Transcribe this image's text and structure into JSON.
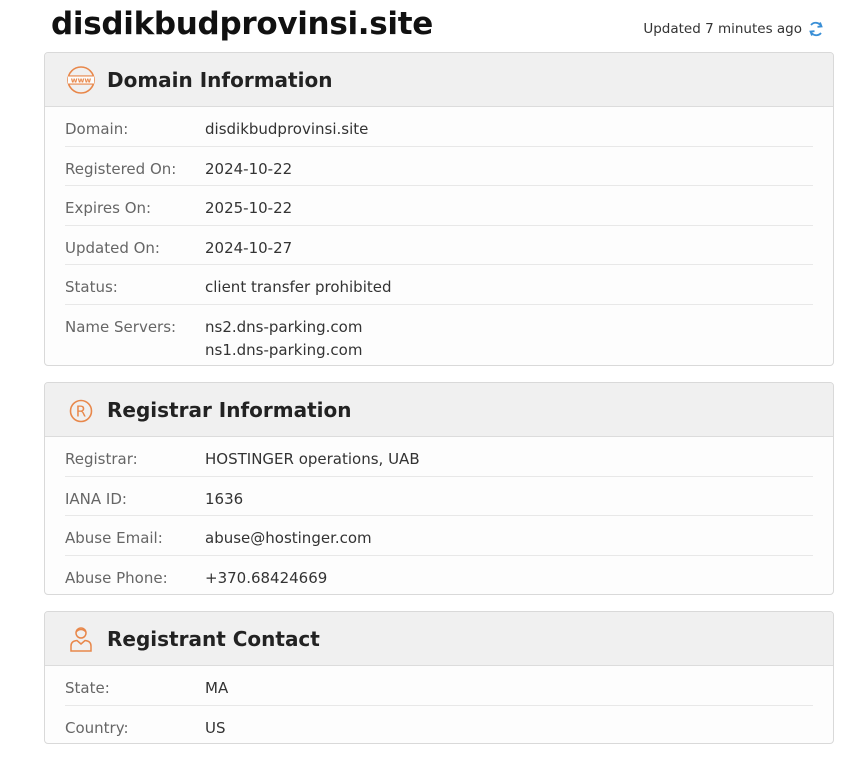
{
  "header": {
    "site_title": "disdikbudprovinsi.site",
    "updated_text": "Updated 7 minutes ago",
    "refresh_icon": "refresh-icon"
  },
  "domain_info": {
    "title": "Domain Information",
    "icon": "www-icon",
    "rows": [
      {
        "label": "Domain:",
        "value": "disdikbudprovinsi.site"
      },
      {
        "label": "Registered On:",
        "value": "2024-10-22"
      },
      {
        "label": "Expires On:",
        "value": "2025-10-22"
      },
      {
        "label": "Updated On:",
        "value": "2024-10-27"
      },
      {
        "label": "Status:",
        "value": "client transfer prohibited"
      }
    ],
    "name_servers_label": "Name Servers:",
    "name_servers": [
      "ns2.dns-parking.com",
      "ns1.dns-parking.com"
    ]
  },
  "registrar_info": {
    "title": "Registrar Information",
    "icon": "registered-icon",
    "rows": [
      {
        "label": "Registrar:",
        "value": "HOSTINGER operations, UAB"
      },
      {
        "label": "IANA ID:",
        "value": "1636"
      },
      {
        "label": "Abuse Email:",
        "value": "abuse@hostinger.com"
      },
      {
        "label": "Abuse Phone:",
        "value": "+370.68424669"
      }
    ]
  },
  "registrant_contact": {
    "title": "Registrant Contact",
    "icon": "person-icon",
    "rows": [
      {
        "label": "State:",
        "value": "MA"
      },
      {
        "label": "Country:",
        "value": "US"
      }
    ]
  },
  "colors": {
    "accent": "#e8874a",
    "refresh": "#3a8fd6"
  }
}
